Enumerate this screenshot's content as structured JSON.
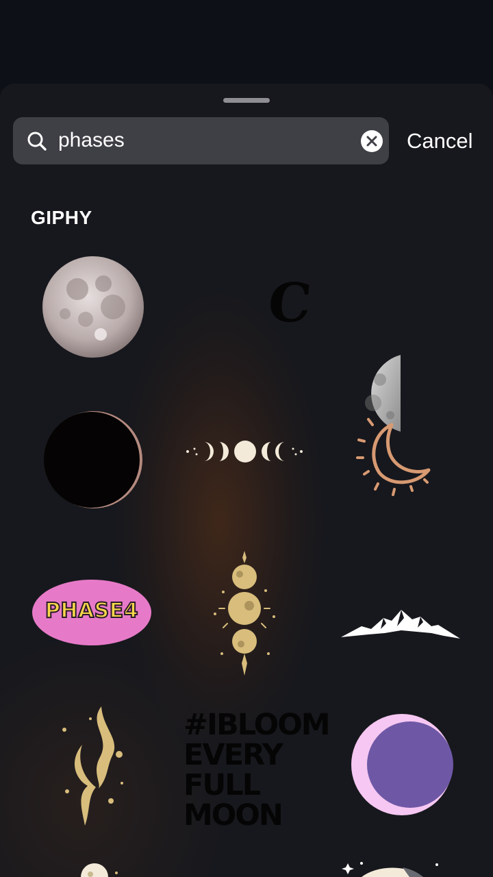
{
  "search": {
    "query": "phases",
    "cancel_label": "Cancel"
  },
  "section": {
    "label": "GIPHY"
  },
  "stickers": {
    "gothic_letter": "C",
    "phase4_text": "PHASE4",
    "ibloom_lines": [
      "#IBLOOM",
      "EVERY",
      "FULL",
      "MOON"
    ]
  },
  "colors": {
    "sheet_bg": "#17181d",
    "search_bg": "#3f4046",
    "phase4_pink": "#e77ac8",
    "phase4_yellow": "#f5d64a",
    "crescent_outline": "#d89a72",
    "gold": "#d8bd7c",
    "purple_moon": "#6e58a6",
    "pink_moon": "#f6c7f2"
  }
}
